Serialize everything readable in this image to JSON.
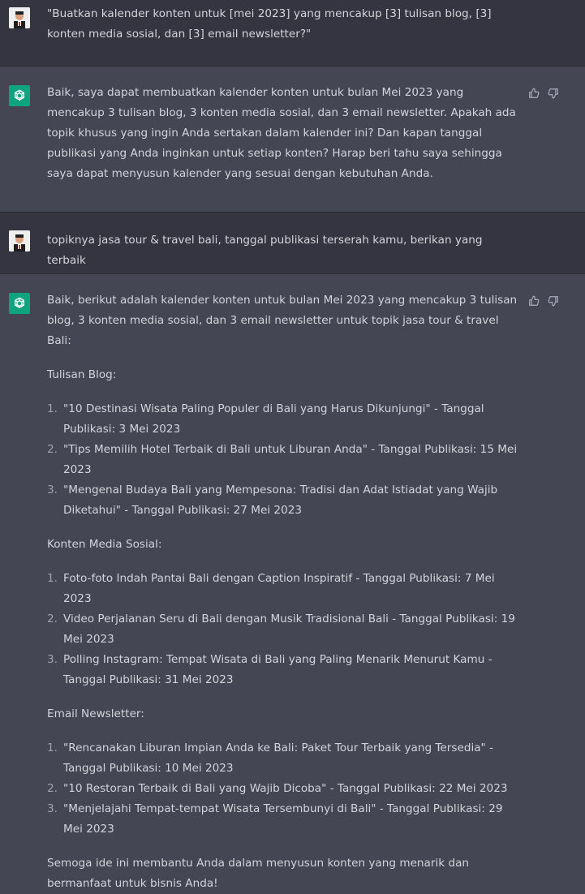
{
  "messages": [
    {
      "role": "user",
      "text": "\"Buatkan kalender konten untuk [mei 2023] yang mencakup [3] tulisan blog, [3] konten media sosial, dan [3] email newsletter?\""
    },
    {
      "role": "assistant",
      "text": "Baik, saya dapat membuatkan kalender konten untuk bulan Mei 2023 yang mencakup 3 tulisan blog, 3 konten media sosial, dan 3 email newsletter. Apakah ada topik khusus yang ingin Anda sertakan dalam kalender ini? Dan kapan tanggal publikasi yang Anda inginkan untuk setiap konten? Harap beri tahu saya sehingga saya dapat menyusun kalender yang sesuai dengan kebutuhan Anda."
    },
    {
      "role": "user",
      "text": "topiknya jasa tour & travel bali, tanggal publikasi terserah kamu, berikan yang terbaik"
    },
    {
      "role": "assistant",
      "intro": "Baik, berikut adalah kalender konten untuk bulan Mei 2023 yang mencakup 3 tulisan blog, 3 konten media sosial, dan 3 email newsletter untuk topik jasa tour & travel Bali:",
      "sections": [
        {
          "heading": "Tulisan Blog:",
          "items": [
            "\"10 Destinasi Wisata Paling Populer di Bali yang Harus Dikunjungi\" - Tanggal Publikasi: 3 Mei 2023",
            "\"Tips Memilih Hotel Terbaik di Bali untuk Liburan Anda\" - Tanggal Publikasi: 15 Mei 2023",
            "\"Mengenal Budaya Bali yang Mempesona: Tradisi dan Adat Istiadat yang Wajib Diketahui\" - Tanggal Publikasi: 27 Mei 2023"
          ]
        },
        {
          "heading": "Konten Media Sosial:",
          "items": [
            "Foto-foto Indah Pantai Bali dengan Caption Inspiratif - Tanggal Publikasi: 7 Mei 2023",
            "Video Perjalanan Seru di Bali dengan Musik Tradisional Bali - Tanggal Publikasi: 19 Mei 2023",
            "Polling Instagram: Tempat Wisata di Bali yang Paling Menarik Menurut Kamu - Tanggal Publikasi: 31 Mei 2023"
          ]
        },
        {
          "heading": "Email Newsletter:",
          "items": [
            "\"Rencanakan Liburan Impian Anda ke Bali: Paket Tour Terbaik yang Tersedia\" - Tanggal Publikasi: 10 Mei 2023",
            "\"10 Restoran Terbaik di Bali yang Wajib Dicoba\" - Tanggal Publikasi: 22 Mei 2023",
            "\"Menjelajahi Tempat-tempat Wisata Tersembunyi di Bali\" - Tanggal Publikasi: 29 Mei 2023"
          ]
        }
      ],
      "outro": "Semoga ide ini membantu Anda dalam menyusun konten yang menarik dan bermanfaat untuk bisnis Anda!"
    }
  ],
  "numbers": [
    "1.",
    "2.",
    "3."
  ],
  "icons": {
    "assistant_avatar": "openai-logo-icon",
    "user_avatar": "user-photo-avatar",
    "like": "thumbs-up-icon",
    "dislike": "thumbs-down-icon"
  },
  "colors": {
    "user_bg": "#343541",
    "assistant_bg": "#444654",
    "accent": "#10a37f",
    "text": "#d1d5db"
  }
}
